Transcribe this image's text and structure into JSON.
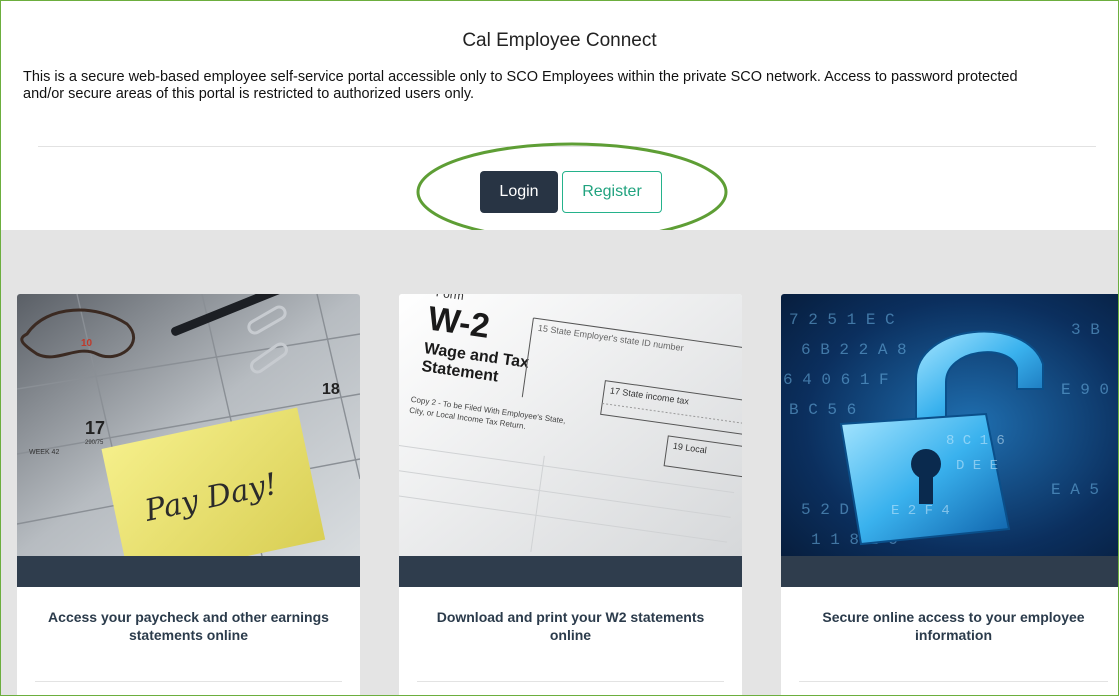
{
  "header": {
    "title": "Cal Employee Connect",
    "description_line1": "This is a secure web-based employee self-service portal accessible only to SCO Employees within the private SCO network. Access to password protected",
    "description_line2": "and/or secure areas of this portal is restricted to authorized users only."
  },
  "actions": {
    "login_label": "Login",
    "register_label": "Register"
  },
  "cards": [
    {
      "image": "payday-calendar-image",
      "calendar_number_1": "17",
      "calendar_number_2": "18",
      "calendar_number_3": "10",
      "calendar_week": "WEEK 42",
      "calendar_day": "290/75",
      "note_text": "Pay Day!",
      "caption": "Access your paycheck and other earnings statements online"
    },
    {
      "image": "w2-form-image",
      "form_label": "Form",
      "form_title": "W-2",
      "form_subtitle1": "Wage and Tax",
      "form_subtitle2": "Statement",
      "form_field1": "15 State  Employer's state ID number",
      "form_field2": "17 State income tax",
      "form_field3": "19 Local",
      "form_copy_line1": "Copy 2 - To be Filed With Employee's State,",
      "form_copy_line2": "City, or Local Income Tax Return.",
      "caption": "Download and print your W2 statements online"
    },
    {
      "image": "digital-padlock-image",
      "caption": "Secure online access to your employee information"
    }
  ],
  "colors": {
    "frame_border": "#6cae3e",
    "login_bg": "#283444",
    "register_accent": "#24b28b",
    "card_strip": "#2f3d4d",
    "highlight_ellipse": "#5e9e35"
  }
}
